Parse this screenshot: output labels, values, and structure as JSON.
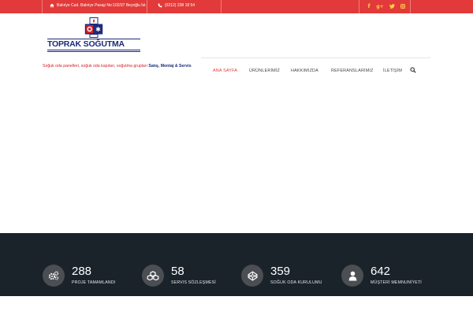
{
  "topbar": {
    "address": "Balıriye Cad. Balıriye Pasajı No:102/37 Beyoğlu İst.",
    "phone": "(0212) 238 18 54",
    "social": [
      "facebook-icon",
      "google-plus-icon",
      "twitter-icon",
      "instagram-icon"
    ]
  },
  "logo": {
    "title": "TOPRAK SOĞUTMA"
  },
  "tagline": {
    "red": "Soğuk oda panelleri, soğuk oda kapıları, soğutma grupları",
    "blue": "Satış, Montaj & Servis"
  },
  "nav": {
    "items": [
      {
        "label": "ANA SAYFA",
        "active": true
      },
      {
        "label": "ÜRÜNLERİMİZ"
      },
      {
        "label": "HAKKIMIZDA"
      },
      {
        "label": "REFERANSLARIMIZ"
      },
      {
        "label": "İLETİŞİM"
      }
    ]
  },
  "stats": [
    {
      "value": "288",
      "label": "PROJE TAMAMLANDI",
      "icon": "gears-icon"
    },
    {
      "value": "58",
      "label": "SERVIS SÖZLEŞMESİ",
      "icon": "cubes-icon"
    },
    {
      "value": "359",
      "label": "SOĞUK ODA KURULUMU",
      "icon": "codepen-icon"
    },
    {
      "value": "642",
      "label": "MÜŞTERİ MEMNUNİYETİ",
      "icon": "user-icon"
    }
  ],
  "colors": {
    "topbar": "#e23a3a",
    "brand_blue": "#1c2b7a",
    "stats_bg": "#1b232a",
    "social_icon": "#ffd24a"
  }
}
